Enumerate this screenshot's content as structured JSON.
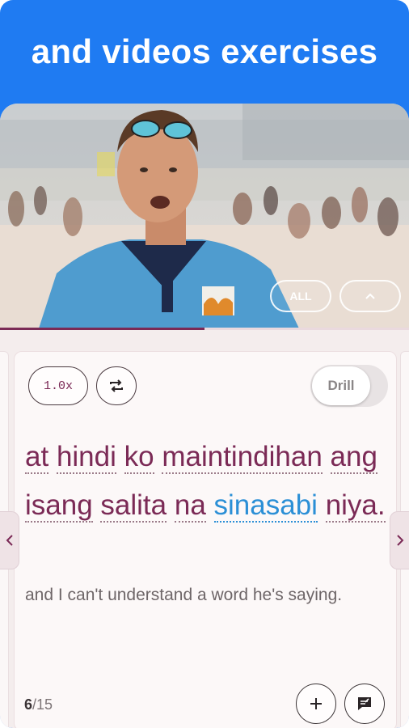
{
  "banner": {
    "title": "and videos exercises"
  },
  "video": {
    "all_label": "ALL",
    "collapse_icon": "chevron-up-icon",
    "progress_fraction": 0.5
  },
  "card": {
    "speed_label": "1.0x",
    "repeat_icon": "repeat-icon",
    "drill_label": "Drill",
    "drill_on": false,
    "phrase_words": [
      "at",
      "hindi",
      "ko",
      "maintindihan",
      "ang",
      "isang",
      "salita",
      "na",
      "sinasabi",
      "niya."
    ],
    "highlighted_word": "sinasabi",
    "translation": "and I can't understand a word he's saying.",
    "counter_current": "6",
    "counter_total": "/15",
    "add_icon": "plus-icon",
    "comment_icon": "comment-icon"
  },
  "nav": {
    "prev_icon": "chevron-left-icon",
    "next_icon": "chevron-right-icon"
  },
  "colors": {
    "brand_blue": "#1f7bf2",
    "accent": "#7b2a56",
    "highlight": "#2b8fd6"
  }
}
